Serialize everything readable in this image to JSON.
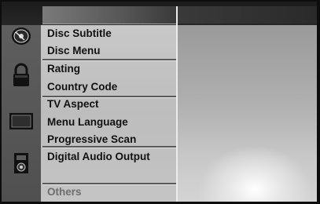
{
  "menu": {
    "items": [
      {
        "label": "Disc Subtitle"
      },
      {
        "label": "Disc Menu"
      },
      {
        "label": "Rating"
      },
      {
        "label": "Country Code"
      },
      {
        "label": "TV Aspect"
      },
      {
        "label": "Menu Language"
      },
      {
        "label": "Progressive Scan"
      },
      {
        "label": "Digital Audio Output"
      },
      {
        "label": "Others"
      }
    ]
  },
  "icons": [
    "disc-icon",
    "lock-icon",
    "tv-icon",
    "speaker-icon"
  ],
  "colors": {
    "menu_bg": "#c4c4c4",
    "text": "#111111",
    "text_dim": "#6e6e6e",
    "icon_column": "#585858"
  }
}
